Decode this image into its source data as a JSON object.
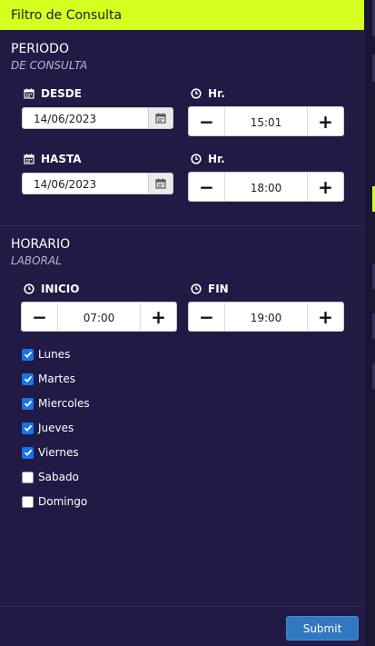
{
  "header": {
    "title": "Filtro de Consulta"
  },
  "periodo": {
    "title": "PERIODO",
    "subtitle": "DE CONSULTA",
    "desde": {
      "label": "DESDE",
      "date": "14/06/2023",
      "hr_label": "Hr.",
      "time": "15:01"
    },
    "hasta": {
      "label": "HASTA",
      "date": "14/06/2023",
      "hr_label": "Hr.",
      "time": "18:00"
    }
  },
  "horario": {
    "title": "HORARIO",
    "subtitle": "LABORAL",
    "inicio": {
      "label": "INICIO",
      "time": "07:00"
    },
    "fin": {
      "label": "FIN",
      "time": "19:00"
    }
  },
  "days": [
    {
      "label": "Lunes",
      "checked": true
    },
    {
      "label": "Martes",
      "checked": true
    },
    {
      "label": "Miercoles",
      "checked": true
    },
    {
      "label": "Jueves",
      "checked": true
    },
    {
      "label": "Viernes",
      "checked": true
    },
    {
      "label": "Sabado",
      "checked": false
    },
    {
      "label": "Domingo",
      "checked": false
    }
  ],
  "submit_label": "Submit",
  "stepper": {
    "minus": "−",
    "plus": "+"
  },
  "colors": {
    "header": "#d4ff1f",
    "panel": "#201a45",
    "accent": "#1a73e8",
    "submit": "#3278c0"
  },
  "icons": {
    "calendar": "calendar-icon",
    "clock": "clock-icon",
    "check": "check-icon"
  }
}
